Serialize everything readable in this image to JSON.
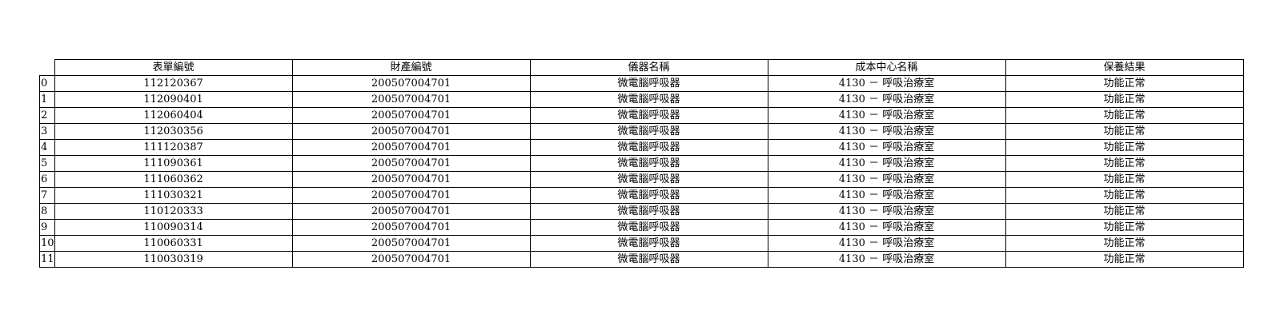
{
  "table": {
    "columns": [
      "表單編號",
      "財產編號",
      "儀器名稱",
      "成本中心名稱",
      "保養結果"
    ],
    "rows": [
      {
        "index": "0",
        "cells": [
          "112120367",
          "200507004701",
          "微電腦呼吸器",
          "4130 － 呼吸治療室",
          "功能正常"
        ]
      },
      {
        "index": "1",
        "cells": [
          "112090401",
          "200507004701",
          "微電腦呼吸器",
          "4130 － 呼吸治療室",
          "功能正常"
        ]
      },
      {
        "index": "2",
        "cells": [
          "112060404",
          "200507004701",
          "微電腦呼吸器",
          "4130 － 呼吸治療室",
          "功能正常"
        ]
      },
      {
        "index": "3",
        "cells": [
          "112030356",
          "200507004701",
          "微電腦呼吸器",
          "4130 － 呼吸治療室",
          "功能正常"
        ]
      },
      {
        "index": "4",
        "cells": [
          "111120387",
          "200507004701",
          "微電腦呼吸器",
          "4130 － 呼吸治療室",
          "功能正常"
        ]
      },
      {
        "index": "5",
        "cells": [
          "111090361",
          "200507004701",
          "微電腦呼吸器",
          "4130 － 呼吸治療室",
          "功能正常"
        ]
      },
      {
        "index": "6",
        "cells": [
          "111060362",
          "200507004701",
          "微電腦呼吸器",
          "4130 － 呼吸治療室",
          "功能正常"
        ]
      },
      {
        "index": "7",
        "cells": [
          "111030321",
          "200507004701",
          "微電腦呼吸器",
          "4130 － 呼吸治療室",
          "功能正常"
        ]
      },
      {
        "index": "8",
        "cells": [
          "110120333",
          "200507004701",
          "微電腦呼吸器",
          "4130 － 呼吸治療室",
          "功能正常"
        ]
      },
      {
        "index": "9",
        "cells": [
          "110090314",
          "200507004701",
          "微電腦呼吸器",
          "4130 － 呼吸治療室",
          "功能正常"
        ]
      },
      {
        "index": "10",
        "cells": [
          "110060331",
          "200507004701",
          "微電腦呼吸器",
          "4130 － 呼吸治療室",
          "功能正常"
        ]
      },
      {
        "index": "11",
        "cells": [
          "110030319",
          "200507004701",
          "微電腦呼吸器",
          "4130 － 呼吸治療室",
          "功能正常"
        ]
      }
    ]
  }
}
